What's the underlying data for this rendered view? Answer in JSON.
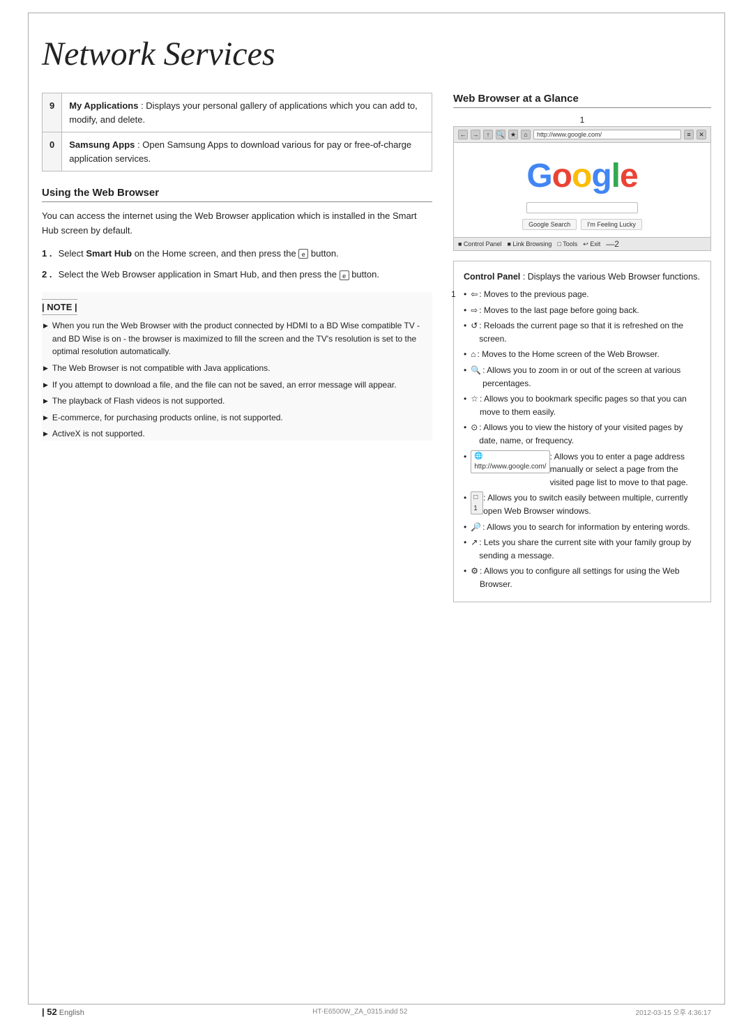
{
  "page": {
    "title": "Network Services",
    "footer": {
      "page_number": "52",
      "language": "English",
      "filename": "HT-E6500W_ZA_0315.indd  52",
      "date": "2012-03-15  오후 4:36:17"
    }
  },
  "left_column": {
    "table_rows": [
      {
        "number": "9",
        "title": "My Applications",
        "description": ": Displays your personal gallery of applications which you can add to, modify, and delete."
      },
      {
        "number": "0",
        "title": "Samsung Apps",
        "description": ": Open Samsung Apps to download various for pay or free-of-charge application services."
      }
    ],
    "web_browser_section": {
      "heading": "Using the Web Browser",
      "intro": "You can access the internet using the Web Browser application which is installed in the Smart Hub screen by default.",
      "steps": [
        {
          "num": "1 .",
          "text": "Select Smart Hub on the Home screen, and then press the  button."
        },
        {
          "num": "2 .",
          "text": "Select the Web Browser application in Smart Hub, and then press the  button."
        }
      ],
      "note_title": "| NOTE |",
      "note_items": [
        "When you run the Web Browser with the product connected by HDMI to a BD Wise compatible TV - and BD Wise is on - the browser is maximized to fill the screen and the TV's resolution is set to the optimal resolution automatically.",
        "The Web Browser is not compatible with Java applications.",
        "If you attempt to download a file, and the file can not be saved, an error message will appear.",
        "The playback of Flash videos is not supported.",
        "E-commerce, for purchasing products online, is not supported.",
        "ActiveX is not supported."
      ]
    }
  },
  "right_column": {
    "glance_heading": "Web Browser at a Glance",
    "browser_mockup": {
      "label_1": "1",
      "label_2": "2",
      "address_bar_url": "http://www.google.com/",
      "google_logo": "Google",
      "search_btn": "Google Search",
      "lucky_btn": "I'm Feeling Lucky",
      "status_items": [
        "Control Panel",
        "Link Browsing",
        "Tools",
        "Exit"
      ]
    },
    "control_panel": {
      "intro_title": "Control Panel",
      "intro_text": ": Displays the various Web Browser functions.",
      "bullet_items": [
        ": Moves to the previous page.",
        ": Moves to the last page before going back.",
        ": Reloads the current page so that it is refreshed on the screen.",
        ": Moves to the Home screen of the Web Browser.",
        ": Allows you to zoom in or out of the screen at various percentages.",
        ": Allows you to bookmark specific pages so that you can move to them easily.",
        ": Allows you to view the history of your visited pages by date, name, or frequency.",
        ": Allows you to enter a page address manually or select a page from the visited page list to move to that page.",
        ": Allows you to switch easily between multiple, currently open Web Browser windows.",
        ": Allows you to search for information by entering words.",
        ": Lets you share the current site with your family group by sending a message.",
        ": Allows you to configure all settings for using the Web Browser."
      ]
    }
  }
}
